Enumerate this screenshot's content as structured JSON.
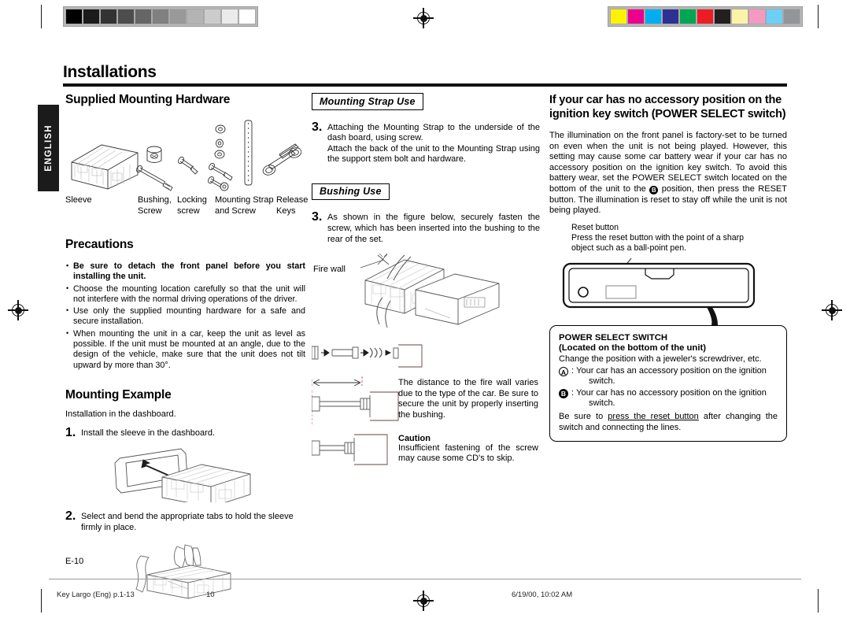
{
  "page": {
    "title": "Installations",
    "language_tab": "ENGLISH",
    "page_number": "E-10"
  },
  "footer": {
    "file": "Key Largo (Eng) p.1-13",
    "number": "10",
    "date": "6/19/00, 10:02 AM"
  },
  "calibration": {
    "gray_strip": [
      "#000000",
      "#1b1b1b",
      "#333333",
      "#4d4d4d",
      "#666666",
      "#808080",
      "#999999",
      "#b3b3b3",
      "#cccccc",
      "#ebebeb",
      "#ffffff"
    ],
    "color_strip": [
      "#fff200",
      "#ec008c",
      "#00aeef",
      "#2e3192",
      "#00a651",
      "#ed1c24",
      "#231f20",
      "#fbf3a8",
      "#f49ac1",
      "#6dcff6",
      "#939598"
    ]
  },
  "left_column": {
    "hardware_heading": "Supplied Mounting Hardware",
    "hardware_labels": [
      {
        "line1": "Sleeve",
        "line2": ""
      },
      {
        "line1": "Bushing,",
        "line2": "Screw"
      },
      {
        "line1": "Locking",
        "line2": "screw"
      },
      {
        "line1": "Mounting Strap",
        "line2": "and Screw"
      },
      {
        "line1": "Release",
        "line2": "Keys"
      }
    ],
    "precautions_heading": "Precautions",
    "precautions": [
      {
        "bold": true,
        "text": "Be sure to detach the front panel before you start installing the unit."
      },
      {
        "bold": false,
        "text": "Choose the mounting location carefully so that the unit will not interfere with the normal driving operations of the driver."
      },
      {
        "bold": false,
        "text": "Use only the supplied mounting hardware for a safe and secure installation."
      },
      {
        "bold": false,
        "text": "When mounting the unit in a car, keep the unit as level as possible. If the unit must be mounted at an angle, due to the design of the vehicle, make sure that the unit does not tilt upward by more than 30°."
      }
    ],
    "mounting_example_heading": "Mounting Example",
    "mounting_example_intro": "Installation in the dashboard.",
    "step1_number": "1.",
    "step1_text": "Install the sleeve in the dashboard.",
    "step2_number": "2.",
    "step2_text": "Select and bend the appropriate tabs to hold the sleeve firmly in place."
  },
  "middle_column": {
    "strap_heading": "Mounting Strap Use",
    "strap_step_number": "3.",
    "strap_step_text": "Attaching the Mounting Strap to the underside of the dash board, using screw.\nAttach the back of the unit to the Mounting Strap using the support stem bolt and hardware.",
    "bushing_heading": "Bushing Use",
    "bushing_step_number": "3.",
    "bushing_step_text": "As shown in the figure below, securely fasten the screw, which has been inserted into the bushing to the rear of the set.",
    "fire_wall_label": "Fire wall",
    "distance_text": "The distance to the fire wall varies due to the type of the car. Be sure to secure the unit by properly inserting the bushing.",
    "caution_heading": "Caution",
    "caution_text": "Insufficient fastening of the screw may cause some CD's to skip."
  },
  "right_column": {
    "heading": "If your car has no accessory position on the ignition key switch (POWER SELECT switch)",
    "body": "The illumination on the front panel is factory-set to be turned on even when the unit is not being played. However, this setting may cause some car battery wear if your car has no accessory position on the ignition key switch. To avoid this battery wear, set the POWER SELECT switch located on the bottom of the unit to the ",
    "body_after_mark": " position, then press the RESET button. The illumination is reset to stay off while the unit is not being played.",
    "body_mark": "B",
    "reset_caption_title": "Reset button",
    "reset_caption_text": "Press the reset button with the point of a sharp object such as a ball-point pen.",
    "power_box": {
      "title": "POWER SELECT SWITCH",
      "subtitle": "(Located on the bottom of the unit)",
      "intro": "Change the position with a jeweler's screwdriver, etc.",
      "options": [
        {
          "mark": "A",
          "mark_style": "outline",
          "text": "Your car has an accessory position on the ignition",
          "indent": "switch."
        },
        {
          "mark": "B",
          "mark_style": "filled",
          "text": "Your car has no accessory position on the ignition",
          "indent": "switch."
        }
      ],
      "footer_pre": "Be sure to ",
      "footer_underlined": "press the reset button",
      "footer_post": " after changing the switch and connecting the lines."
    }
  }
}
